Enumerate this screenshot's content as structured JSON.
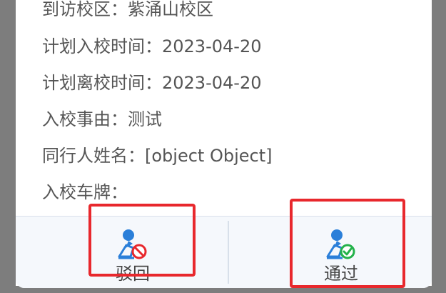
{
  "details": [
    {
      "label": "到访校区：",
      "value": "紫涌山校区"
    },
    {
      "label": "计划入校时间：",
      "value": "2023-04-20"
    },
    {
      "label": "计划离校时间：",
      "value": "2023-04-20"
    },
    {
      "label": "入校事由：",
      "value": "测试"
    },
    {
      "label": "同行人姓名：",
      "value": "[object Object]"
    },
    {
      "label": "入校车牌：",
      "value": ""
    }
  ],
  "actions": {
    "reject": {
      "label": "驳回",
      "icon": "person-reject-icon"
    },
    "approve": {
      "label": "通过",
      "icon": "person-approve-icon"
    }
  },
  "colors": {
    "accent_blue": "#2a7fd9",
    "reject_red": "#e8282d",
    "approve_green": "#23b24a",
    "highlight_red": "#e8282d"
  }
}
